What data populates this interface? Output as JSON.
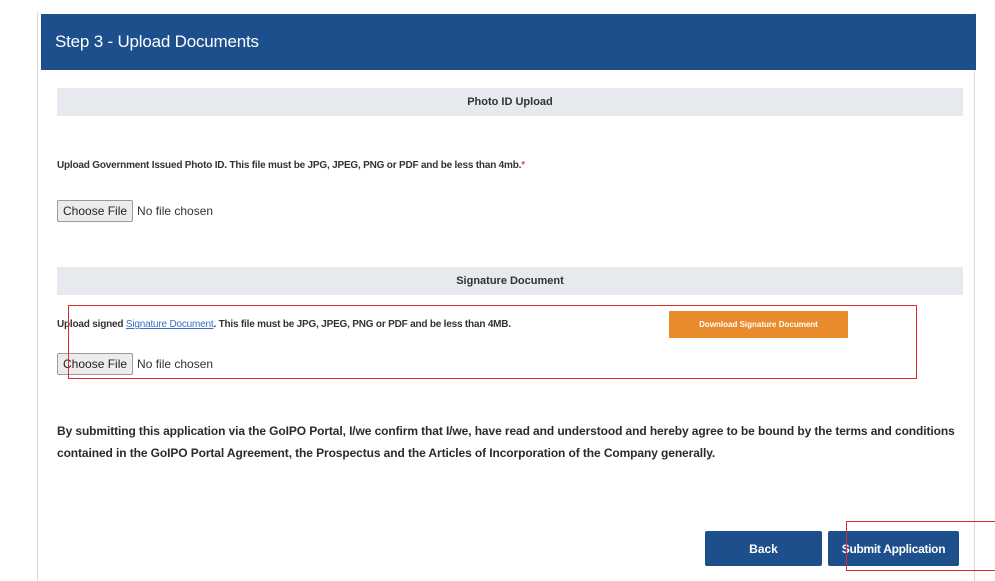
{
  "header": {
    "title": "Step 3 - Upload Documents"
  },
  "photo_id": {
    "section_title": "Photo ID Upload",
    "instruction": "Upload Government Issued Photo ID. This file must be JPG, JPEG, PNG or PDF and be less than 4mb.",
    "required_marker": "*",
    "choose_label": "Choose File",
    "file_status": "No file chosen"
  },
  "signature": {
    "section_title": "Signature Document",
    "instruction_prefix": "Upload signed ",
    "link_text": "Signature Document",
    "instruction_suffix": ". This file must be JPG, JPEG, PNG or PDF and be less than 4MB.",
    "download_label": "Download Signature Document",
    "choose_label": "Choose File",
    "file_status": "No file chosen"
  },
  "agreement": {
    "text": "By submitting this application via the GoIPO Portal, I/we confirm that I/we, have read and understood and hereby agree to be bound by the terms and conditions contained in the GoIPO Portal Agreement, the Prospectus and the Articles of Incorporation of the Company generally."
  },
  "actions": {
    "back_label": "Back",
    "submit_label": "Submit Application"
  },
  "colors": {
    "header_bg": "#1d4f8c",
    "section_bg": "#e6e9ee",
    "download_bg": "#e98a2d",
    "highlight": "#e02a2a"
  }
}
